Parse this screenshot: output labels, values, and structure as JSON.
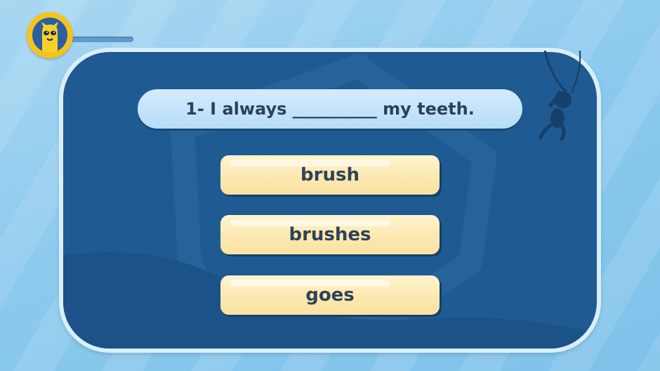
{
  "progress": {
    "fraction": 0.0
  },
  "question": {
    "text": "1- I always __________ my teeth."
  },
  "answers": [
    {
      "label": "brush"
    },
    {
      "label": "brushes"
    },
    {
      "label": "goes"
    }
  ],
  "colors": {
    "panel": "#1f5a92",
    "accent_yellow": "#f6c21c",
    "answer_fill": "#fce8b1",
    "question_fill": "#c6e4fb"
  },
  "icons": {
    "avatar": "yellow-monster-icon",
    "decoration": "hanging-monkey-icon"
  }
}
